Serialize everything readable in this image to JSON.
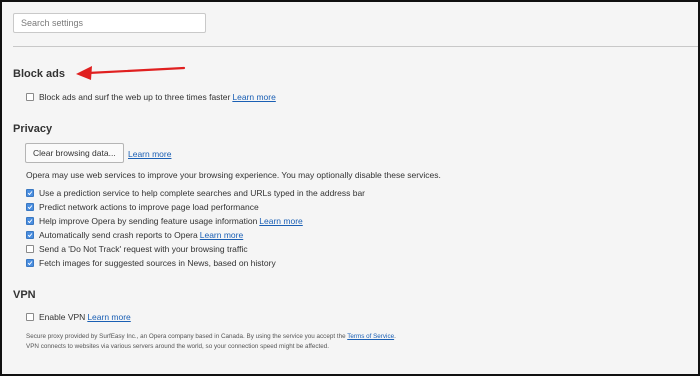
{
  "search": {
    "placeholder": "Search settings"
  },
  "block_ads": {
    "heading": "Block ads",
    "option_label": "Block ads and surf the web up to three times faster",
    "learn_more": "Learn more",
    "checked": false
  },
  "privacy": {
    "heading": "Privacy",
    "clear_button": "Clear browsing data...",
    "clear_learn_more": "Learn more",
    "info": "Opera may use web services to improve your browsing experience. You may optionally disable these services.",
    "options": [
      {
        "label": "Use a prediction service to help complete searches and URLs typed in the address bar",
        "checked": true
      },
      {
        "label": "Predict network actions to improve page load performance",
        "checked": true
      },
      {
        "label": "Help improve Opera by sending feature usage information",
        "checked": true,
        "link": "Learn more"
      },
      {
        "label": "Automatically send crash reports to Opera",
        "checked": true,
        "link": "Learn more"
      },
      {
        "label": "Send a 'Do Not Track' request with your browsing traffic",
        "checked": false
      },
      {
        "label": "Fetch images for suggested sources in News, based on history",
        "checked": true
      }
    ]
  },
  "vpn": {
    "heading": "VPN",
    "option_label": "Enable VPN",
    "learn_more": "Learn more",
    "checked": false,
    "fine_print_1a": "Secure proxy provided by SurfEasy Inc., an Opera company based in Canada. By using the service you accept the",
    "terms_link": "Terms of Service",
    "fine_print_1b": ".",
    "fine_print_2": "VPN connects to websites via various servers around the world, so your connection speed might be affected."
  },
  "colors": {
    "accent": "#1a5fb4",
    "checkbox_checked": "#4a8ee0",
    "annotation_arrow": "#e02020"
  },
  "annotation": {
    "icon": "red-arrow-icon"
  }
}
